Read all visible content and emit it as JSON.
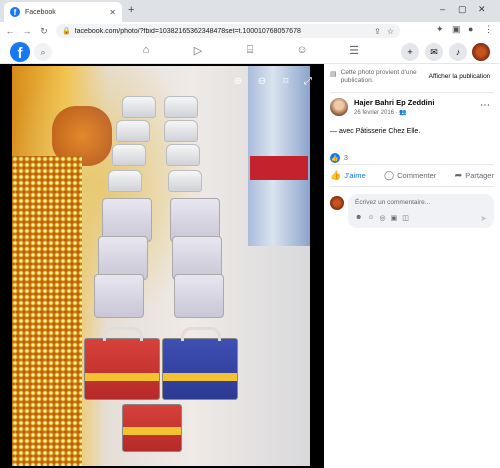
{
  "browser": {
    "tab_title": "Facebook",
    "tab_close": "✕",
    "new_tab": "+",
    "url": "facebook.com/photo/?fbid=10382165362348478set=t.100010768057678",
    "window_controls": [
      "–",
      "▢",
      "✕"
    ]
  },
  "fb_header": {
    "logo": "f",
    "nav_icons": [
      "home-icon",
      "video-icon",
      "marketplace-icon",
      "groups-icon",
      "menu-icon"
    ],
    "right_icons": [
      "create-icon",
      "messenger-icon",
      "notifications-icon"
    ]
  },
  "photo": {
    "controls": [
      "zoom-in-icon",
      "zoom-out-icon",
      "tag-icon",
      "fullscreen-icon"
    ]
  },
  "panel": {
    "notice_text": "Cette photo provient d'une publication.",
    "notice_link": "Afficher la publication",
    "author_name": "Hajer Bahri Ep Zeddini",
    "post_date": "26 février 2016 · ",
    "caption_prefix": "— avec ",
    "caption_tag": "Pâtisserie Chez Elle",
    "caption_suffix": ".",
    "like_count": "3",
    "actions": {
      "like": "J'aime",
      "comment": "Commenter",
      "share": "Partager"
    },
    "comment_placeholder": "Écrivez un commentaire..."
  },
  "colors": {
    "fb_blue": "#1877f2",
    "secondary_text": "#65676b"
  }
}
